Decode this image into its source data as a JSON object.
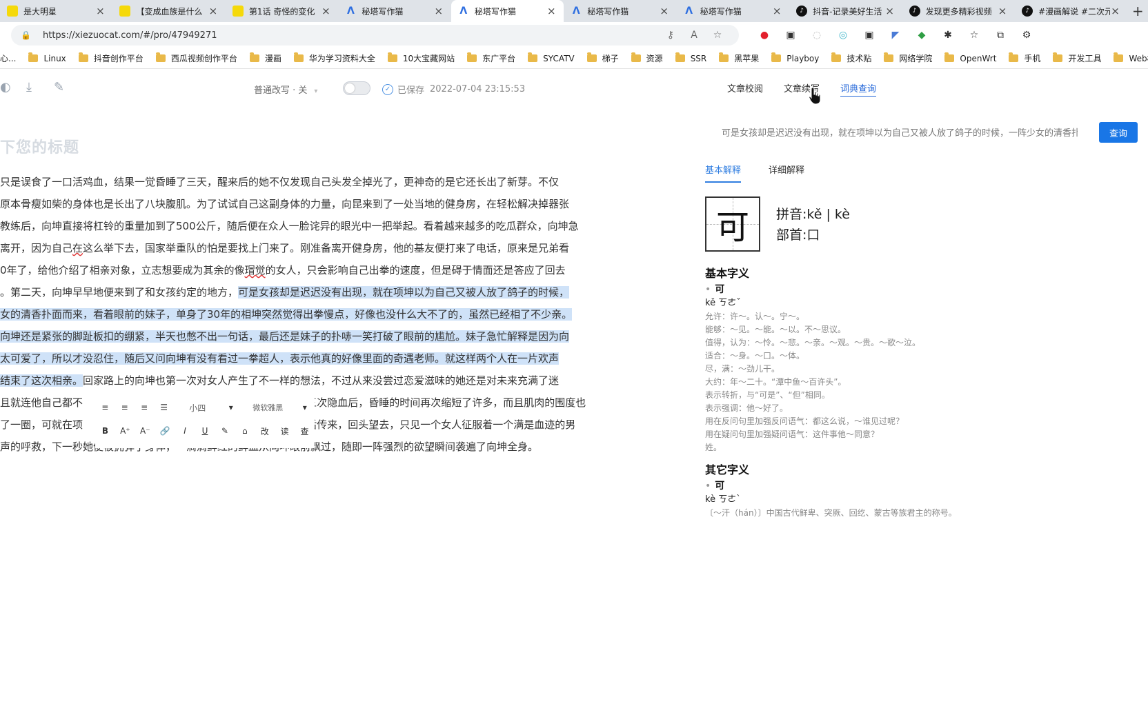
{
  "tabs": [
    {
      "label": "是大明星",
      "icon": "yellow",
      "icon_text": "",
      "active": false
    },
    {
      "label": "【变成血族是什么",
      "icon": "yellow",
      "icon_text": "",
      "active": false
    },
    {
      "label": "第1话 奇怪的变化",
      "icon": "yellow",
      "icon_text": "",
      "active": false
    },
    {
      "label": "秘塔写作猫",
      "icon": "mita",
      "icon_text": "Λ",
      "active": false
    },
    {
      "label": "秘塔写作猫",
      "icon": "mita",
      "icon_text": "Λ",
      "active": true
    },
    {
      "label": "秘塔写作猫",
      "icon": "mita",
      "icon_text": "Λ",
      "active": false
    },
    {
      "label": "秘塔写作猫",
      "icon": "mita",
      "icon_text": "Λ",
      "active": false
    },
    {
      "label": "抖音-记录美好生活",
      "icon": "tiktok",
      "icon_text": "♪",
      "active": false
    },
    {
      "label": "发现更多精彩视频",
      "icon": "tiktok",
      "icon_text": "♪",
      "active": false
    },
    {
      "label": "#漫画解说 #二次元",
      "icon": "tiktok",
      "icon_text": "♪",
      "active": false
    }
  ],
  "new_tab": "+",
  "address": {
    "url": "https://xiezuocat.com/#/pro/47949271"
  },
  "bookmarks": [
    "心...",
    "Linux",
    "抖音创作平台",
    "西瓜视频创作平台",
    "漫画",
    "华为学习资料大全",
    "10大宝藏网站",
    "东广平台",
    "SYCATV",
    "梯子",
    "资源",
    "SSR",
    "黑苹果",
    "Playboy",
    "技术贴",
    "网络学院",
    "OpenWrt",
    "手机",
    "开发工具",
    "Web模版"
  ],
  "toolbar": {
    "mode": "普通改写 · 关",
    "saved_label": "已保存",
    "saved_time": "2022-07-04 23:15:53",
    "right_tabs": [
      "文章校阅",
      "文章续写",
      "词典查询"
    ]
  },
  "doc": {
    "title": "下您的标题",
    "lines": [
      {
        "pre": "只是误食了一口活鸡血，结果一觉昏睡了三天，醒来后的她不仅发现自己头发全掉光了，更神奇的是它还长出了新芽。不仅",
        "sel": "",
        "post": ""
      },
      {
        "pre": "原本骨瘦如柴的身体也是长出了八块腹肌。为了试试自己这副身体的力量，向昆来到了一处当地的健身房，在轻松解决掉器张",
        "sel": "",
        "post": ""
      },
      {
        "pre": "教练后，向坤直接将杠铃的重量加到了500公斤，随后便在众人一脸诧异的眼光中一把举起。看着越来越多的吃瓜群众，向坤急",
        "sel": "",
        "post": ""
      },
      {
        "pre": "离开，因为自己",
        "squig": "在",
        "pre2": "这么举下去，国家举重队的怕是要找上门来了。刚准备离开健身房，他的基友便打来了电话，原来是兄弟看",
        "sel": "",
        "post": ""
      },
      {
        "pre": "0年了，给他介绍了相亲对象，立志想要成为其余的像",
        "squig": "瑁觉",
        "pre2": "的女人，只会影响自己出拳的速度，但是碍于情面还是答应了回去",
        "sel": "",
        "post": ""
      },
      {
        "pre": "。第二天，向坤早早地便来到了和女孩约定的地方，",
        "sel": "可是女孩却是迟迟没有出现，就在项坤以为自己又被人放了鸽子的时候，",
        "post": ""
      },
      {
        "pre": "",
        "sel": "女的清香扑面而来，看着眼前的妹子，单身了30年的相坤突然觉得出拳慢点，好像也没什么大不了的，虽然已经相了不少亲。",
        "post": ""
      },
      {
        "pre": "",
        "sel": "向坤还是紧张的脚趾板扣的绷紧，半天也憋不出一句话，最后还是妹子的扑哧一笑打破了眼前的尴尬。妹子急忙解释是因为向",
        "post": ""
      },
      {
        "pre": "",
        "sel": "太可爱了，所以才没忍住，随后又问向坤有没有看过一拳超人，表示他真的好像里面的奇遇老师。就这样两个人在一片欢声",
        "post": ""
      },
      {
        "pre": "",
        "sel": "结束了这次相亲。",
        "post": "回家路上的向坤也第一次对女人产生了不一样的想法，不过从来没尝过恋爱滋味的她还是对未来充满了迷"
      },
      {
        "pre": "且就连他自己都不",
        "mid": "                                                                    ",
        "pre2": "三次隐血后，昏睡的时间再次缩短了许多，而且肌肉的围度也",
        "sel": "",
        "post": ""
      },
      {
        "pre": "了一圈，可就在项",
        "mid": "                                                                    ",
        "pre2": "后传来，回头望去，只见一个女人征服着一个满是血迹的男",
        "sel": "",
        "post": ""
      },
      {
        "pre": "声的呼救，下一秒她便被拥弹了身体，一滴滴鲜红的鲜血从向坤眼前飘过，随即一阵强烈的欲望瞬间袭遍了向坤全身。",
        "sel": "",
        "post": ""
      }
    ]
  },
  "format_toolbar": {
    "row1": [
      "≡",
      "≡",
      "≡",
      "☰",
      "小四",
      "▾",
      "微软雅黑",
      "▾"
    ],
    "row2": [
      "B",
      "A⁺",
      "A⁻",
      "🔗",
      "I",
      "U",
      "✎",
      "⌂",
      "改",
      "读",
      "查"
    ]
  },
  "dict": {
    "query_text": "可是女孩却是迟迟没有出现，就在项坤以为自己又被人放了鸽子的时候，一阵少女的清香扑",
    "query_button": "查询",
    "tabs": [
      "基本解释",
      "详细解释"
    ],
    "char": "可",
    "pinyin": "拼音:kě | kè",
    "radical": "部首:口",
    "basic_heading": "基本字义",
    "basic_char": "可",
    "basic_pinyin": "kě ㄎㄜˇ",
    "basic_defs": [
      "允许：许～。认～。宁～。",
      "能够：～见。～能。～以。不～思议。",
      "值得，认为：～怜。～悲。～亲。～观。～贵。～歌～泣。",
      "适合：～身。～口。～体。",
      "尽，满：～劲儿干。",
      "大约：年～二十。“潭中鱼～百许头”。",
      "表示转折，与“可是”、“但”相同。",
      "表示强调：他～好了。",
      "用在反问句里加强反问语气：都这么说，～谁见过呢？",
      "用在疑问句里加强疑问语气：这件事他～同意？",
      "姓。"
    ],
    "other_heading": "其它字义",
    "other_char": "可",
    "other_pinyin": "kè ㄎㄜˋ",
    "other_defs": [
      "〔～汗（hán）〕中国古代鲜卑、突厥、回纥、蒙古等族君主的称号。"
    ]
  }
}
